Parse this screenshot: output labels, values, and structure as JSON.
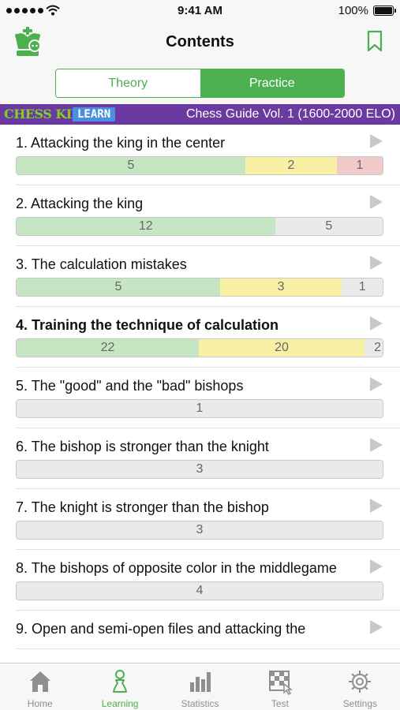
{
  "status": {
    "time": "9:41 AM",
    "battery": "100%"
  },
  "nav": {
    "title": "Contents"
  },
  "segment": {
    "theory": "Theory",
    "practice": "Practice",
    "selected": "Practice"
  },
  "banner": {
    "brand": "CHESS KING",
    "learn": "LEARN",
    "course": "Chess Guide Vol. 1 (1600-2000 ELO)"
  },
  "chapters": [
    {
      "title": "1. Attacking the king in the center",
      "bold": false,
      "progress": [
        {
          "kind": "green",
          "value": "5",
          "count": 5
        },
        {
          "kind": "yellow",
          "value": "2",
          "count": 2
        },
        {
          "kind": "red",
          "value": "1",
          "count": 1
        }
      ]
    },
    {
      "title": "2. Attacking the king",
      "bold": false,
      "progress": [
        {
          "kind": "green",
          "value": "12",
          "count": 12
        },
        {
          "kind": "gray",
          "value": "5",
          "count": 5
        }
      ]
    },
    {
      "title": "3. The calculation mistakes",
      "bold": false,
      "progress": [
        {
          "kind": "green",
          "value": "5",
          "count": 5
        },
        {
          "kind": "yellow",
          "value": "3",
          "count": 3
        },
        {
          "kind": "gray",
          "value": "1",
          "count": 1
        }
      ]
    },
    {
      "title": "4. Training the technique of calculation",
      "bold": true,
      "progress": [
        {
          "kind": "green",
          "value": "22",
          "count": 22
        },
        {
          "kind": "yellow",
          "value": "20",
          "count": 20
        },
        {
          "kind": "gray",
          "value": "2",
          "count": 2
        }
      ]
    },
    {
      "title": "5. The \"good\" and the \"bad\" bishops",
      "bold": false,
      "progress": [
        {
          "kind": "gray",
          "value": "1",
          "count": 1
        }
      ]
    },
    {
      "title": "6. The bishop is stronger than the knight",
      "bold": false,
      "progress": [
        {
          "kind": "gray",
          "value": "3",
          "count": 3
        }
      ]
    },
    {
      "title": "7. The knight is stronger than the bishop",
      "bold": false,
      "progress": [
        {
          "kind": "gray",
          "value": "3",
          "count": 3
        }
      ]
    },
    {
      "title": "8. The bishops of opposite color in the middlegame",
      "bold": false,
      "progress": [
        {
          "kind": "gray",
          "value": "4",
          "count": 4
        }
      ]
    },
    {
      "title": "9. Open and semi-open files and attacking the",
      "bold": false,
      "progress": []
    }
  ],
  "tabs": [
    {
      "label": "Home",
      "icon": "home-icon",
      "active": false
    },
    {
      "label": "Learning",
      "icon": "pawn-icon",
      "active": true
    },
    {
      "label": "Statistics",
      "icon": "bar-chart-icon",
      "active": false
    },
    {
      "label": "Test",
      "icon": "chessboard-icon",
      "active": false
    },
    {
      "label": "Settings",
      "icon": "gear-icon",
      "active": false
    }
  ],
  "colors": {
    "accent": "#4caf50",
    "banner": "#6a3aa0",
    "green": "#c6e6c3",
    "yellow": "#f8f1a4",
    "red": "#f2c9c9",
    "gray": "#eaeaea"
  }
}
